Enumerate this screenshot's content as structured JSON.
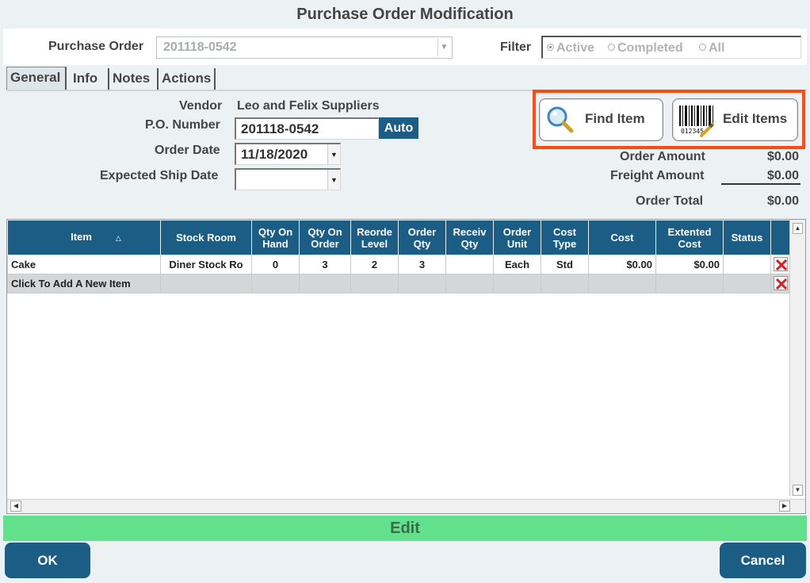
{
  "window": {
    "title": "Purchase Order Modification"
  },
  "top": {
    "po_label": "Purchase Order",
    "po_value": "201118-0542",
    "filter_label": "Filter",
    "filter_options": [
      {
        "label": "Active",
        "selected": true
      },
      {
        "label": "Completed",
        "selected": false
      },
      {
        "label": "All",
        "selected": false
      }
    ]
  },
  "tabs": [
    "General",
    "Info",
    "Notes",
    "Actions"
  ],
  "general": {
    "vendor_label": "Vendor",
    "vendor_value": "Leo and Felix Suppliers",
    "po_number_label": "P.O. Number",
    "po_number_value": "201118-0542",
    "auto_label": "Auto",
    "order_date_label": "Order Date",
    "order_date_value": "11/18/2020",
    "ship_date_label": "Expected Ship Date",
    "ship_date_value": ""
  },
  "tools": {
    "find_item": "Find Item",
    "edit_items": "Edit Items"
  },
  "totals": {
    "order_amount_label": "Order Amount",
    "order_amount": "$0.00",
    "freight_amount_label": "Freight Amount",
    "freight_amount": "$0.00",
    "order_total_label": "Order Total",
    "order_total": "$0.00"
  },
  "grid": {
    "columns": [
      "Item",
      "Stock Room",
      "Qty On Hand",
      "Qty On Order",
      "Reorde Level",
      "Order Qty",
      "Receiv Qty",
      "Order Unit",
      "Cost Type",
      "Cost",
      "Extented Cost",
      "Status"
    ],
    "rows": [
      {
        "item": "Cake",
        "stock_room": "Diner Stock Ro",
        "qty_on_hand": "0",
        "qty_on_order": "3",
        "reorder_level": "2",
        "order_qty": "3",
        "receiv_qty": "",
        "order_unit": "Each",
        "cost_type": "Std",
        "cost": "$0.00",
        "extended_cost": "$0.00",
        "status": ""
      }
    ],
    "add_row_label": "Click To Add A New Item"
  },
  "status_bar": "Edit",
  "buttons": {
    "ok": "OK",
    "cancel": "Cancel"
  },
  "colors": {
    "header_blue": "#1c5d86",
    "status_green": "#62e08c",
    "highlight": "#ff4a12"
  }
}
